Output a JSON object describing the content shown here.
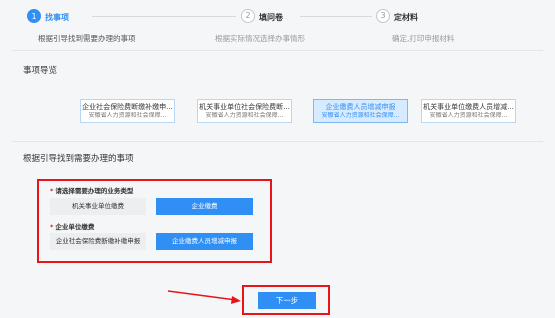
{
  "steps": [
    {
      "number": "1",
      "title": "找事项",
      "desc": "根据引导找到需要办理的事项",
      "active": true
    },
    {
      "number": "2",
      "title": "填问卷",
      "desc": "根据实际情况选择办事情形",
      "active": false
    },
    {
      "number": "3",
      "title": "定材料",
      "desc": "确定,打印申报材料",
      "active": false
    }
  ],
  "nav_section": {
    "title": "事项导览",
    "cards": [
      {
        "line1": "企业社会保险费断缴补缴申...",
        "line2": "安徽省人力资源和社会保障..."
      },
      {
        "line1": "机关事业单位社会保险费断...",
        "line2": "安徽省人力资源和社会保障..."
      },
      {
        "line1": "企业缴费人员增减申报",
        "line2": "安徽省人力资源和社会保障..."
      },
      {
        "line1": "机关事业单位缴费人员增减...",
        "line2": "安徽省人力资源和社会保障..."
      }
    ]
  },
  "guide_section": {
    "title": "根据引导找到需要办理的事项",
    "q1": {
      "label": "请选择需要办理的业务类型",
      "options": [
        "机关事业单位缴费",
        "企业缴费"
      ]
    },
    "q2": {
      "label": "企业单位缴费",
      "options": [
        "企业社会保险费断缴补缴申报",
        "企业缴费人员增减申报"
      ]
    }
  },
  "next_button": {
    "label": "下一步"
  },
  "colors": {
    "accent": "#2f8ff5",
    "highlight_red": "#e8141a"
  }
}
